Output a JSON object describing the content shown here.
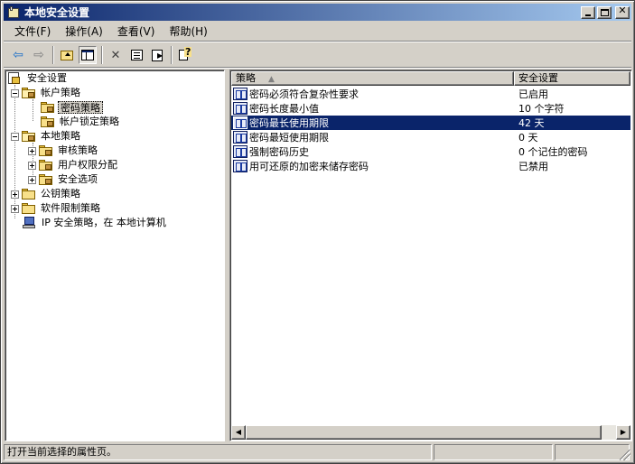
{
  "window": {
    "title": "本地安全设置",
    "minimize_glyph": "_",
    "close_glyph": "✕"
  },
  "menu": [
    "文件(F)",
    "操作(A)",
    "查看(V)",
    "帮助(H)"
  ],
  "toolbar": {
    "back_glyph": "⇦",
    "forward_glyph": "⇨",
    "delete_glyph": "✕"
  },
  "tree": {
    "root": "安全设置",
    "account_policies": "帐户策略",
    "password_policy": "密码策略",
    "lockout_policy": "帐户锁定策略",
    "local_policies": "本地策略",
    "audit_policy": "审核策略",
    "user_rights": "用户权限分配",
    "security_options": "安全选项",
    "public_key": "公钥策略",
    "software_restriction": "软件限制策略",
    "ip_security": "IP 安全策略，在 本地计算机"
  },
  "list": {
    "col_policy": "策略",
    "col_setting": "安全设置",
    "sort_glyph": "▲",
    "rows": [
      {
        "policy": "密码必须符合复杂性要求",
        "setting": "已启用"
      },
      {
        "policy": "密码长度最小值",
        "setting": "10 个字符"
      },
      {
        "policy": "密码最长使用期限",
        "setting": "42 天"
      },
      {
        "policy": "密码最短使用期限",
        "setting": "0 天"
      },
      {
        "policy": "强制密码历史",
        "setting": "0 个记住的密码"
      },
      {
        "policy": "用可还原的加密来储存密码",
        "setting": "已禁用"
      }
    ],
    "selected_index": 2,
    "scroll_left_glyph": "◀",
    "scroll_right_glyph": "▶"
  },
  "status": {
    "text": "打开当前选择的属性页。"
  }
}
